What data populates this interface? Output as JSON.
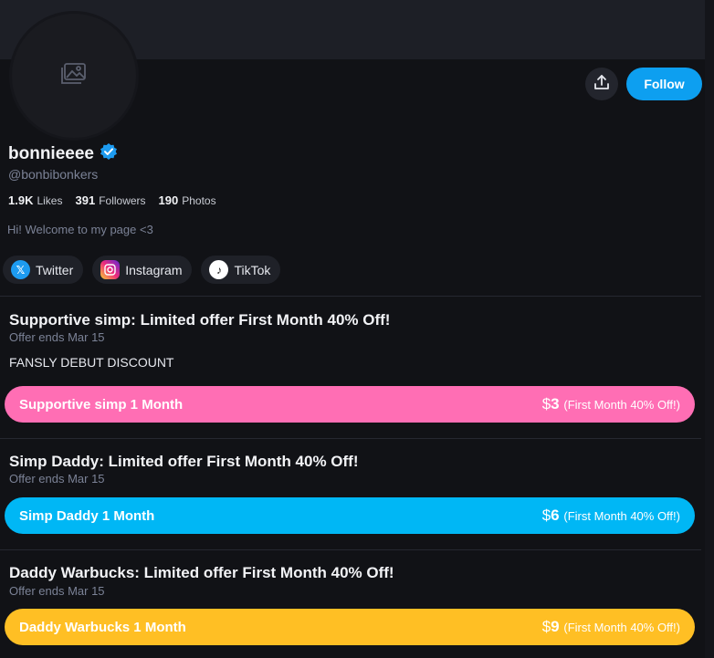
{
  "profile": {
    "display_name": "bonnieeee",
    "handle": "@bonbibonkers",
    "bio": "Hi! Welcome to my page <3",
    "follow_label": "Follow",
    "stats": [
      {
        "value": "1.9K",
        "label": "Likes"
      },
      {
        "value": "391",
        "label": "Followers"
      },
      {
        "value": "190",
        "label": "Photos"
      }
    ],
    "socials": [
      {
        "label": "Twitter",
        "icon": "twitter-icon"
      },
      {
        "label": "Instagram",
        "icon": "instagram-icon"
      },
      {
        "label": "TikTok",
        "icon": "tiktok-icon"
      }
    ]
  },
  "tiers": [
    {
      "title": "Supportive simp: Limited offer First Month 40% Off!",
      "ends": "Offer ends Mar 15",
      "description": "FANSLY DEBUT DISCOUNT",
      "button_label": "Supportive simp 1 Month",
      "currency": "$",
      "price": "3",
      "price_note": "(First Month 40% Off!)",
      "color": "#ff6eb4"
    },
    {
      "title": "Simp Daddy: Limited offer First Month 40% Off!",
      "ends": "Offer ends Mar 15",
      "button_label": "Simp Daddy 1 Month",
      "currency": "$",
      "price": "6",
      "price_note": "(First Month 40% Off!)",
      "color": "#00b7f5"
    },
    {
      "title": "Daddy Warbucks: Limited offer First Month 40% Off!",
      "ends": "Offer ends Mar 15",
      "button_label": "Daddy Warbucks 1 Month",
      "currency": "$",
      "price": "9",
      "price_note": "(First Month 40% Off!)",
      "color": "#ffbf24"
    }
  ]
}
